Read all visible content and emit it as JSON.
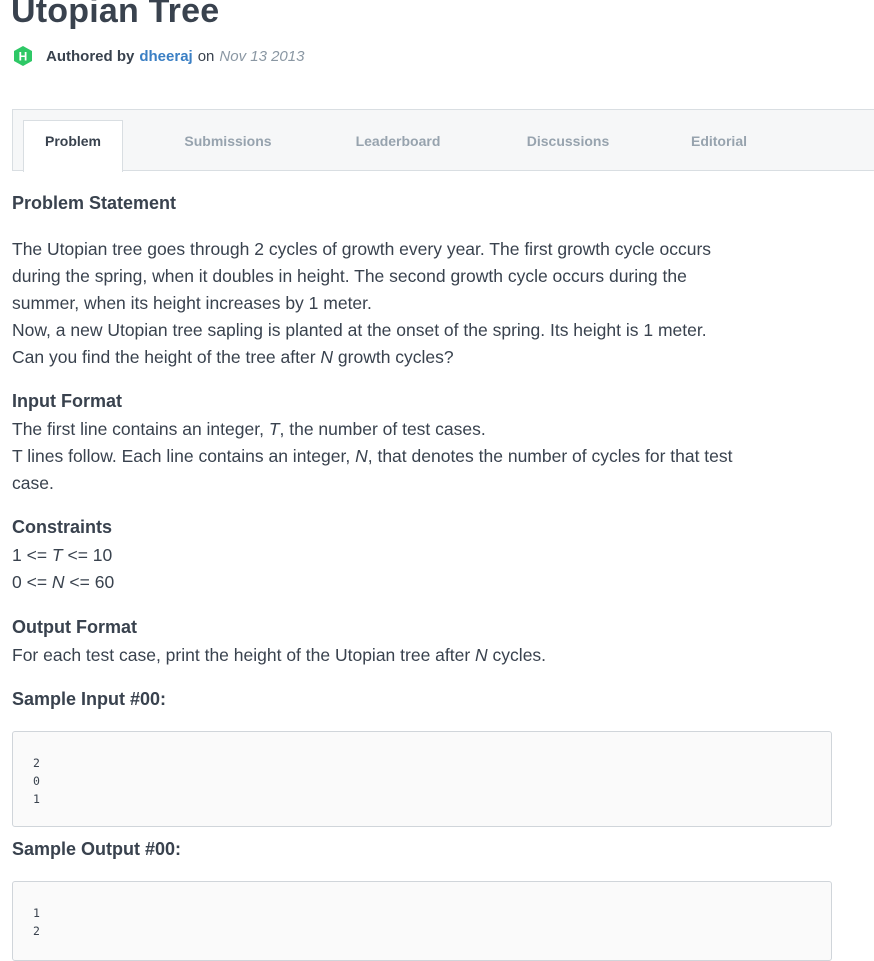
{
  "header": {
    "title": "Utopian Tree",
    "authored_by": "Authored by",
    "author": "dheeraj",
    "on": "on",
    "date": "Nov 13 2013",
    "logo_letter": "H",
    "logo_color": "#2ec866"
  },
  "tabs": [
    {
      "label": "Problem",
      "active": true
    },
    {
      "label": "Submissions",
      "active": false
    },
    {
      "label": "Leaderboard",
      "active": false
    },
    {
      "label": "Discussions",
      "active": false
    },
    {
      "label": "Editorial",
      "active": false
    }
  ],
  "problem_statement": {
    "heading": "Problem Statement",
    "line1": "The Utopian tree goes through 2 cycles of growth every year. The first growth cycle occurs",
    "line2": "during the spring, when it doubles in height. The second growth cycle occurs during the",
    "line3": "summer, when its height increases by 1 meter.",
    "line4": "Now, a new Utopian tree sapling is planted at the onset of the spring. Its height is 1 meter.",
    "line5_pre": "Can you find the height of the tree after ",
    "line5_var": "N",
    "line5_post": " growth cycles?"
  },
  "input_format": {
    "heading": "Input Format",
    "line1_pre": "The first line contains an integer, ",
    "line1_var": "T",
    "line1_post": ", the number of test cases.",
    "line2_pre": "T lines follow. Each line contains an integer, ",
    "line2_var": "N",
    "line2_post": ", that denotes the number of cycles for that test",
    "line3": "case."
  },
  "constraints": {
    "heading": "Constraints",
    "c1_pre": "1 <= ",
    "c1_var": "T",
    "c1_post": " <= 10",
    "c2_pre": "0 <= ",
    "c2_var": "N",
    "c2_post": " <= 60"
  },
  "output_format": {
    "heading": "Output Format",
    "line_pre": "For each test case, print the height of the Utopian tree after ",
    "line_var": "N",
    "line_post": " cycles."
  },
  "sample_input": {
    "heading": "Sample Input #00:",
    "lines": [
      "2",
      "0",
      "1"
    ]
  },
  "sample_output": {
    "heading": "Sample Output #00:",
    "lines": [
      "1",
      "2"
    ]
  }
}
